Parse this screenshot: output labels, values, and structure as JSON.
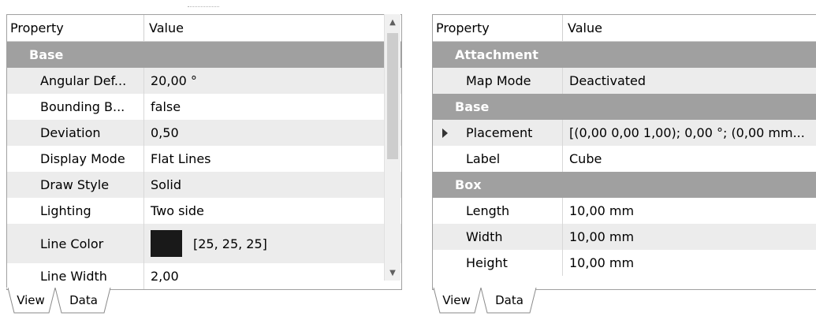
{
  "left": {
    "header": {
      "property": "Property",
      "value": "Value"
    },
    "groups": [
      {
        "name": "Base",
        "rows": [
          {
            "property": "Angular Def...",
            "value": "20,00 °"
          },
          {
            "property": "Bounding B...",
            "value": "false"
          },
          {
            "property": "Deviation",
            "value": "0,50"
          },
          {
            "property": "Display Mode",
            "value": "Flat Lines"
          },
          {
            "property": "Draw Style",
            "value": "Solid"
          },
          {
            "property": "Lighting",
            "value": "Two side"
          },
          {
            "property": "Line Color",
            "value": "[25, 25, 25]",
            "swatch": "#191919"
          },
          {
            "property": "Line Width",
            "value": "2,00"
          }
        ]
      }
    ],
    "tabs": [
      {
        "label": "View",
        "active": true
      },
      {
        "label": "Data",
        "active": false
      }
    ]
  },
  "right": {
    "header": {
      "property": "Property",
      "value": "Value"
    },
    "groups": [
      {
        "name": "Attachment",
        "rows": [
          {
            "property": "Map Mode",
            "value": "Deactivated"
          }
        ]
      },
      {
        "name": "Base",
        "rows": [
          {
            "property": "Placement",
            "value": "[(0,00 0,00 1,00); 0,00 °; (0,00 mm...",
            "expandable": true
          },
          {
            "property": "Label",
            "value": "Cube"
          }
        ]
      },
      {
        "name": "Box",
        "rows": [
          {
            "property": "Length",
            "value": "10,00 mm"
          },
          {
            "property": "Width",
            "value": "10,00 mm"
          },
          {
            "property": "Height",
            "value": "10,00 mm"
          }
        ]
      }
    ],
    "tabs": [
      {
        "label": "View",
        "active": false
      },
      {
        "label": "Data",
        "active": true
      }
    ]
  },
  "colors": {
    "group_header_bg": "#a0a0a0",
    "row_alt_bg": "#ececec",
    "border": "#a0a0a0"
  }
}
